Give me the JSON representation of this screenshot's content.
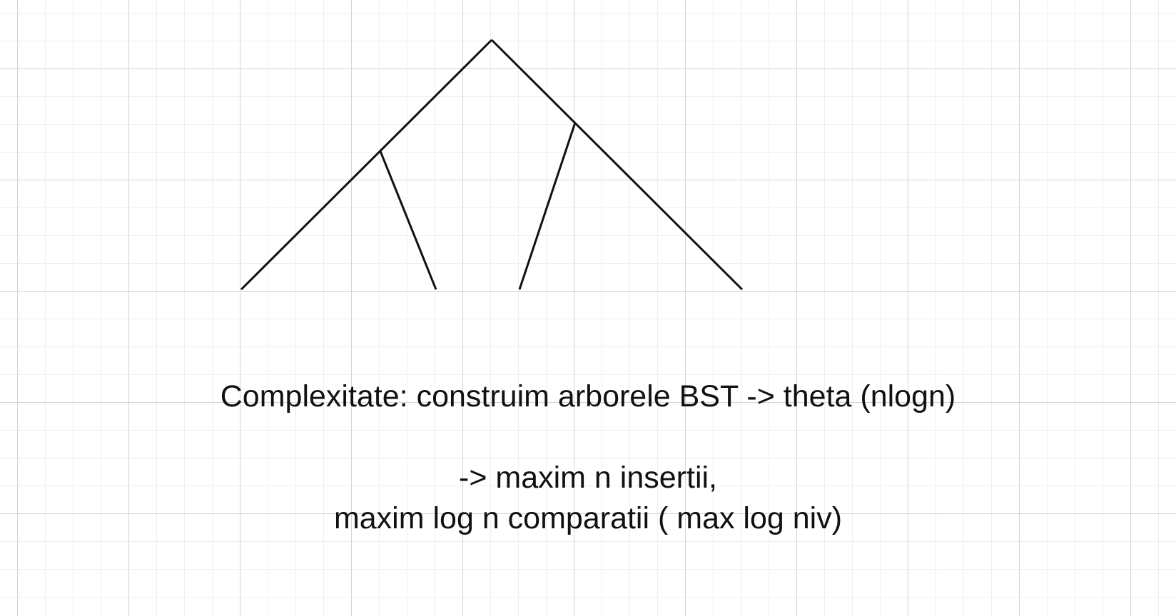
{
  "canvas": {
    "grid_color": "#d4d4d4",
    "line_color": "#111111"
  },
  "text": {
    "line1": "Complexitate: construim arborele BST -> theta (nlogn)",
    "line2": "-> maxim n insertii,",
    "line3": "maxim log n comparatii ( max log niv)"
  }
}
